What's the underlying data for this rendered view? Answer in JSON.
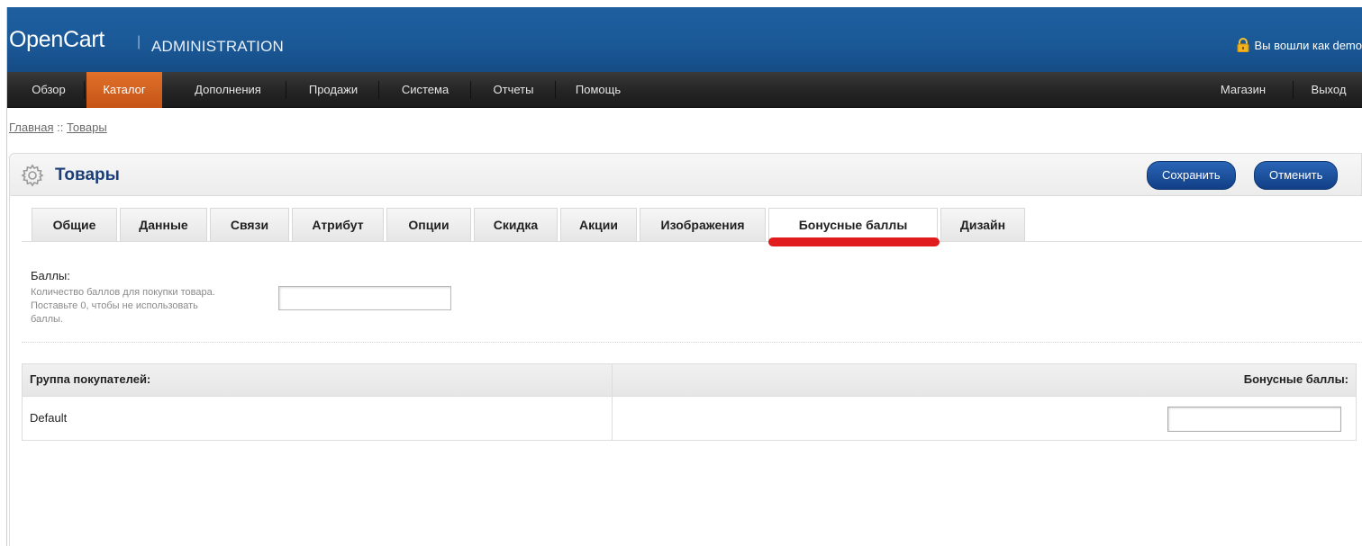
{
  "header": {
    "logo": "OpenCart",
    "separator": "|",
    "subtitle": "ADMINISTRATION",
    "login_text": "Вы вошли как demo",
    "lock_icon": "lock-icon"
  },
  "nav": {
    "items": [
      {
        "label": "Обзор",
        "active": false
      },
      {
        "label": "Каталог",
        "active": true
      },
      {
        "label": "Дополнения",
        "active": false
      },
      {
        "label": "Продажи",
        "active": false
      },
      {
        "label": "Система",
        "active": false
      },
      {
        "label": "Отчеты",
        "active": false
      },
      {
        "label": "Помощь",
        "active": false
      }
    ],
    "right_items": [
      {
        "label": "Магазин"
      },
      {
        "label": "Выход"
      }
    ]
  },
  "breadcrumb": {
    "home": "Главная",
    "separator": " :: ",
    "current": "Товары"
  },
  "page": {
    "title": "Товары",
    "icon": "gear-icon",
    "save_label": "Сохранить",
    "cancel_label": "Отменить"
  },
  "tabs": [
    {
      "label": "Общие"
    },
    {
      "label": "Данные"
    },
    {
      "label": "Связи"
    },
    {
      "label": "Атрибут"
    },
    {
      "label": "Опции"
    },
    {
      "label": "Скидка"
    },
    {
      "label": "Акции"
    },
    {
      "label": "Изображения"
    },
    {
      "label": "Бонусные баллы",
      "active": true
    },
    {
      "label": "Дизайн"
    }
  ],
  "form": {
    "points_label": "Баллы:",
    "points_help": "Количество баллов для покупки товара. Поставьте 0, чтобы не использовать баллы.",
    "points_value": ""
  },
  "reward_table": {
    "headers": [
      "Группа покупателей:",
      "Бонусные баллы:"
    ],
    "rows": [
      {
        "group": "Default",
        "points": ""
      }
    ]
  },
  "colors": {
    "header_blue": "#1a5896",
    "nav_active_orange": "#d4611f",
    "title_blue": "#1b3f78",
    "annotation_red": "#e01c1c"
  }
}
